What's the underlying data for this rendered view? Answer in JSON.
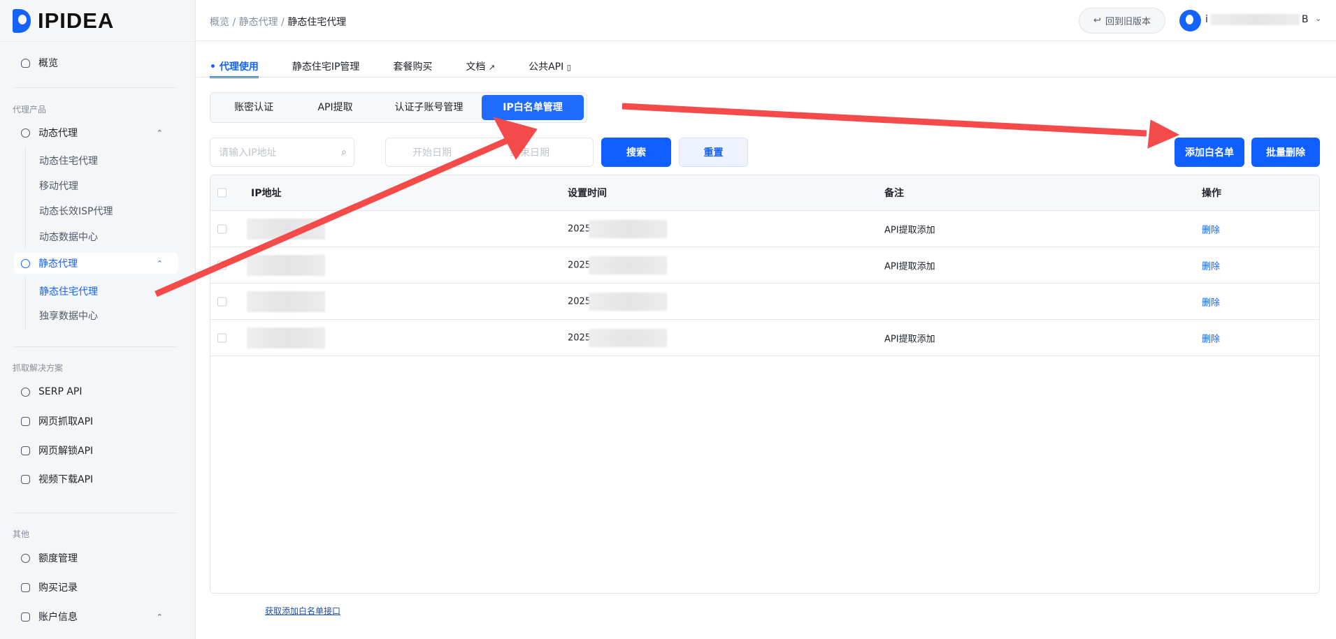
{
  "brand": {
    "name": "IPIDEA"
  },
  "sidebar": {
    "overview": "概览",
    "sections": [
      {
        "title": "代理产品"
      },
      {
        "title": "抓取解决方案"
      },
      {
        "title": "其他"
      }
    ],
    "dynamic": {
      "label": "动态代理",
      "subs": [
        "动态住宅代理",
        "移动代理",
        "动态长效ISP代理",
        "动态数据中心"
      ]
    },
    "static": {
      "label": "静态代理",
      "subs": [
        "静态住宅代理",
        "独享数据中心"
      ]
    },
    "scrape": [
      "SERP API",
      "网页抓取API",
      "网页解锁API",
      "视频下载API"
    ],
    "other": [
      "额度管理",
      "购买记录",
      "账户信息"
    ]
  },
  "header": {
    "breadcrumb": [
      "概览",
      "静态代理",
      "静态住宅代理"
    ],
    "back_label": "回到旧版本",
    "user_prefix": "i",
    "user_suffix": "B"
  },
  "tabs": [
    "代理使用",
    "静态住宅IP管理",
    "套餐购买",
    "文档",
    "公共API"
  ],
  "segments": [
    "账密认证",
    "API提取",
    "认证子账号管理",
    "IP白名单管理"
  ],
  "filters": {
    "ip_placeholder": "请输入IP地址",
    "start_placeholder": "开始日期",
    "end_placeholder": "结束日期",
    "search": "搜索",
    "reset": "重置",
    "add": "添加白名单",
    "batch_delete": "批量删除"
  },
  "table": {
    "columns": [
      "IP地址",
      "设置时间",
      "备注",
      "操作"
    ],
    "rows": [
      {
        "time": "2025",
        "note": "API提取添加",
        "action": "删除"
      },
      {
        "time": "2025",
        "note": "API提取添加",
        "action": "删除"
      },
      {
        "time": "2025",
        "note": "",
        "action": "删除"
      },
      {
        "time": "2025",
        "note": "API提取添加",
        "action": "删除"
      }
    ]
  },
  "footer_link": "获取添加白名单接口",
  "colors": {
    "primary": "#1463ff",
    "annotation_arrow": "#f44a4a"
  }
}
